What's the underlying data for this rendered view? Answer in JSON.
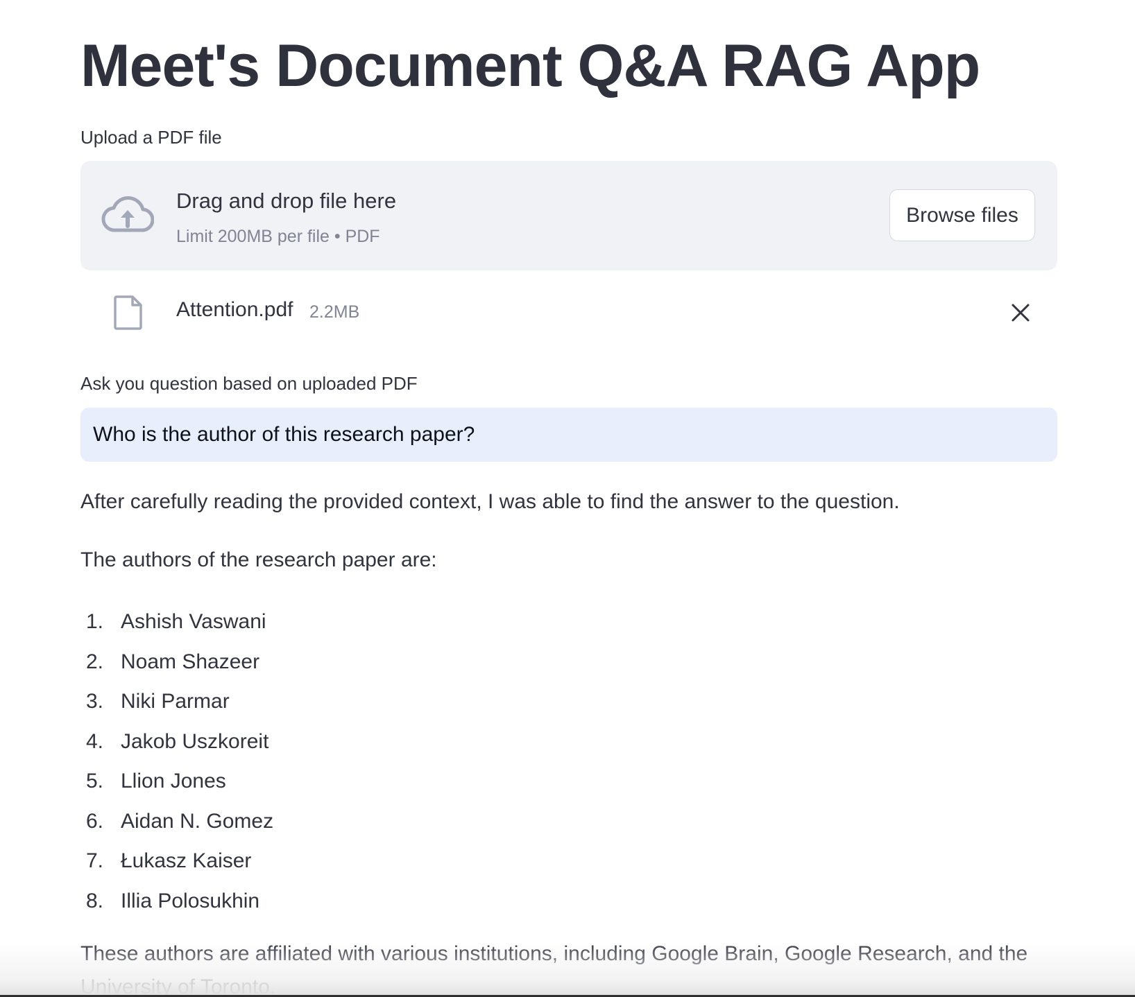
{
  "app": {
    "title": "Meet's Document Q&A RAG App"
  },
  "uploader": {
    "label": "Upload a PDF file",
    "drop_text": "Drag and drop file here",
    "limit_text": "Limit 200MB per file • PDF",
    "browse_label": "Browse files",
    "icon": "cloud-upload-icon"
  },
  "uploaded_file": {
    "name": "Attention.pdf",
    "size": "2.2MB",
    "icon": "file-icon",
    "remove_icon": "close-icon"
  },
  "question": {
    "label": "Ask you question based on uploaded PDF",
    "value": "Who is the author of this research paper?"
  },
  "answer": {
    "intro": "After carefully reading the provided context, I was able to find the answer to the question.",
    "lead": "The authors of the research paper are:",
    "authors": [
      {
        "num": "1.",
        "name": "Ashish Vaswani"
      },
      {
        "num": "2.",
        "name": "Noam Shazeer"
      },
      {
        "num": "3.",
        "name": "Niki Parmar"
      },
      {
        "num": "4.",
        "name": "Jakob Uszkoreit"
      },
      {
        "num": "5.",
        "name": "Llion Jones"
      },
      {
        "num": "6.",
        "name": "Aidan N. Gomez"
      },
      {
        "num": "7.",
        "name": "Łukasz Kaiser"
      },
      {
        "num": "8.",
        "name": "Illia Polosukhin"
      }
    ],
    "closing": "These authors are affiliated with various institutions, including Google Brain, Google Research, and the University of Toronto."
  },
  "colors": {
    "text": "#31333f",
    "title": "#2f313d",
    "muted": "#808495",
    "dropzone_bg": "#f0f2f6",
    "input_bg": "#e8eefc",
    "icon": "#a3a8b8"
  }
}
